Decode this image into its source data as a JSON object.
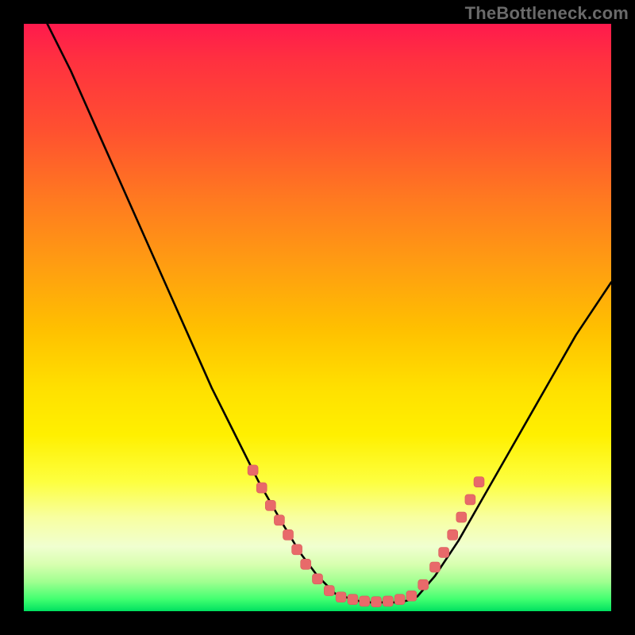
{
  "watermark": "TheBottleneck.com",
  "colors": {
    "curve": "#000000",
    "marker_fill": "#e86a6a",
    "marker_stroke": "#d85a5a",
    "background_black": "#000000"
  },
  "chart_data": {
    "type": "line",
    "title": "",
    "xlabel": "",
    "ylabel": "",
    "xlim": [
      0,
      100
    ],
    "ylim": [
      0,
      100
    ],
    "grid": false,
    "note": "No axes, ticks, or numeric labels are rendered; values below are estimated from pixel positions on a 0–100 normalized grid (origin bottom-left). Lower y = greener band (optimal).",
    "series": [
      {
        "name": "left-branch",
        "x": [
          4,
          8,
          12,
          16,
          20,
          24,
          28,
          32,
          36,
          40,
          44,
          47,
          50,
          53,
          56
        ],
        "y": [
          100,
          92,
          83,
          74,
          65,
          56,
          47,
          38,
          30,
          22,
          15,
          10,
          6,
          3,
          2
        ]
      },
      {
        "name": "valley",
        "x": [
          56,
          58,
          60,
          62,
          64,
          66,
          67
        ],
        "y": [
          2,
          1.5,
          1.5,
          1.5,
          1.5,
          2,
          2.5
        ]
      },
      {
        "name": "right-branch",
        "x": [
          67,
          70,
          74,
          78,
          82,
          86,
          90,
          94,
          98,
          100
        ],
        "y": [
          2.5,
          6,
          12,
          19,
          26,
          33,
          40,
          47,
          53,
          56
        ]
      }
    ],
    "markers": {
      "name": "highlight-dots",
      "shape": "rounded-square",
      "points": [
        {
          "x": 39,
          "y": 24
        },
        {
          "x": 40.5,
          "y": 21
        },
        {
          "x": 42,
          "y": 18
        },
        {
          "x": 43.5,
          "y": 15.5
        },
        {
          "x": 45,
          "y": 13
        },
        {
          "x": 46.5,
          "y": 10.5
        },
        {
          "x": 48,
          "y": 8
        },
        {
          "x": 50,
          "y": 5.5
        },
        {
          "x": 52,
          "y": 3.5
        },
        {
          "x": 54,
          "y": 2.4
        },
        {
          "x": 56,
          "y": 2.0
        },
        {
          "x": 58,
          "y": 1.7
        },
        {
          "x": 60,
          "y": 1.6
        },
        {
          "x": 62,
          "y": 1.7
        },
        {
          "x": 64,
          "y": 2.0
        },
        {
          "x": 66,
          "y": 2.6
        },
        {
          "x": 68,
          "y": 4.5
        },
        {
          "x": 70,
          "y": 7.5
        },
        {
          "x": 71.5,
          "y": 10
        },
        {
          "x": 73,
          "y": 13
        },
        {
          "x": 74.5,
          "y": 16
        },
        {
          "x": 76,
          "y": 19
        },
        {
          "x": 77.5,
          "y": 22
        }
      ]
    }
  }
}
